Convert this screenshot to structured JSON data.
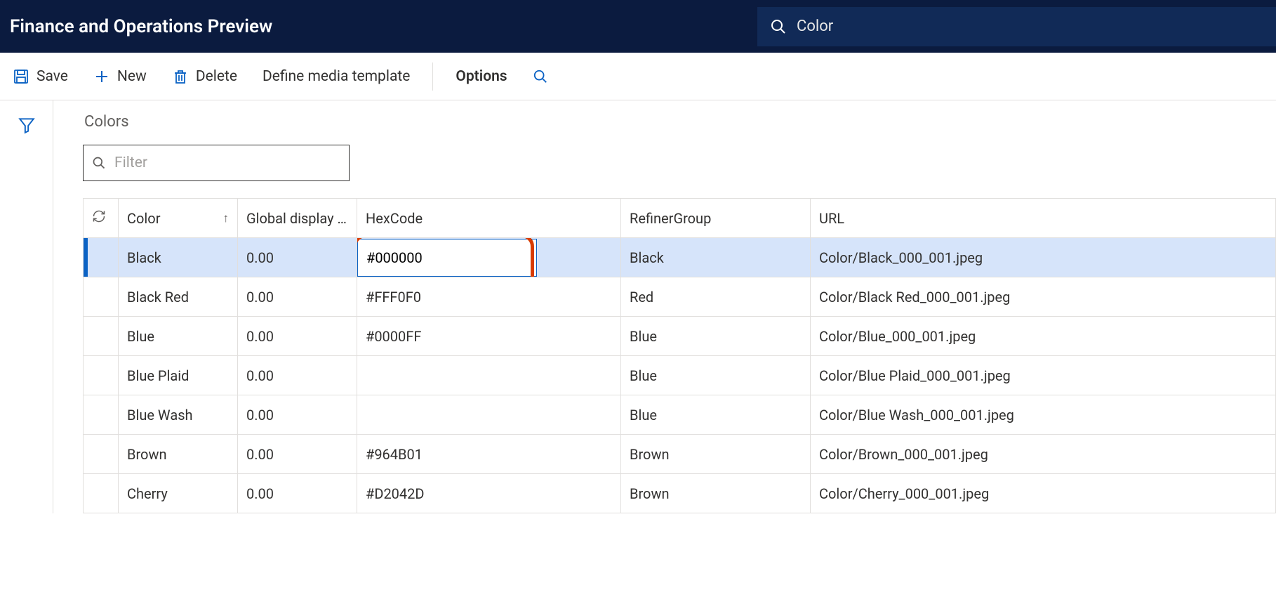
{
  "header": {
    "title": "Finance and Operations Preview",
    "search": "Color"
  },
  "toolbar": {
    "save": "Save",
    "new": "New",
    "delete": "Delete",
    "define_media": "Define media template",
    "options": "Options"
  },
  "page": {
    "subtitle": "Colors",
    "filter_placeholder": "Filter"
  },
  "columns": {
    "color": "Color",
    "gdo": "Global display ...",
    "hex": "HexCode",
    "refiner": "RefinerGroup",
    "url": "URL"
  },
  "rows": [
    {
      "color": "Black",
      "gdo": "0.00",
      "hex": "#000000",
      "refiner": "Black",
      "url": "Color/Black_000_001.jpeg",
      "selected": true,
      "editing": true
    },
    {
      "color": "Black Red",
      "gdo": "0.00",
      "hex": "#FFF0F0",
      "refiner": "Red",
      "url": "Color/Black Red_000_001.jpeg",
      "selected": false,
      "editing": false
    },
    {
      "color": "Blue",
      "gdo": "0.00",
      "hex": "#0000FF",
      "refiner": "Blue",
      "url": "Color/Blue_000_001.jpeg",
      "selected": false,
      "editing": false
    },
    {
      "color": "Blue Plaid",
      "gdo": "0.00",
      "hex": "",
      "refiner": "Blue",
      "url": "Color/Blue Plaid_000_001.jpeg",
      "selected": false,
      "editing": false
    },
    {
      "color": "Blue Wash",
      "gdo": "0.00",
      "hex": "",
      "refiner": "Blue",
      "url": "Color/Blue Wash_000_001.jpeg",
      "selected": false,
      "editing": false
    },
    {
      "color": "Brown",
      "gdo": "0.00",
      "hex": "#964B01",
      "refiner": "Brown",
      "url": "Color/Brown_000_001.jpeg",
      "selected": false,
      "editing": false
    },
    {
      "color": "Cherry",
      "gdo": "0.00",
      "hex": "#D2042D",
      "refiner": "Brown",
      "url": "Color/Cherry_000_001.jpeg",
      "selected": false,
      "editing": false
    }
  ]
}
